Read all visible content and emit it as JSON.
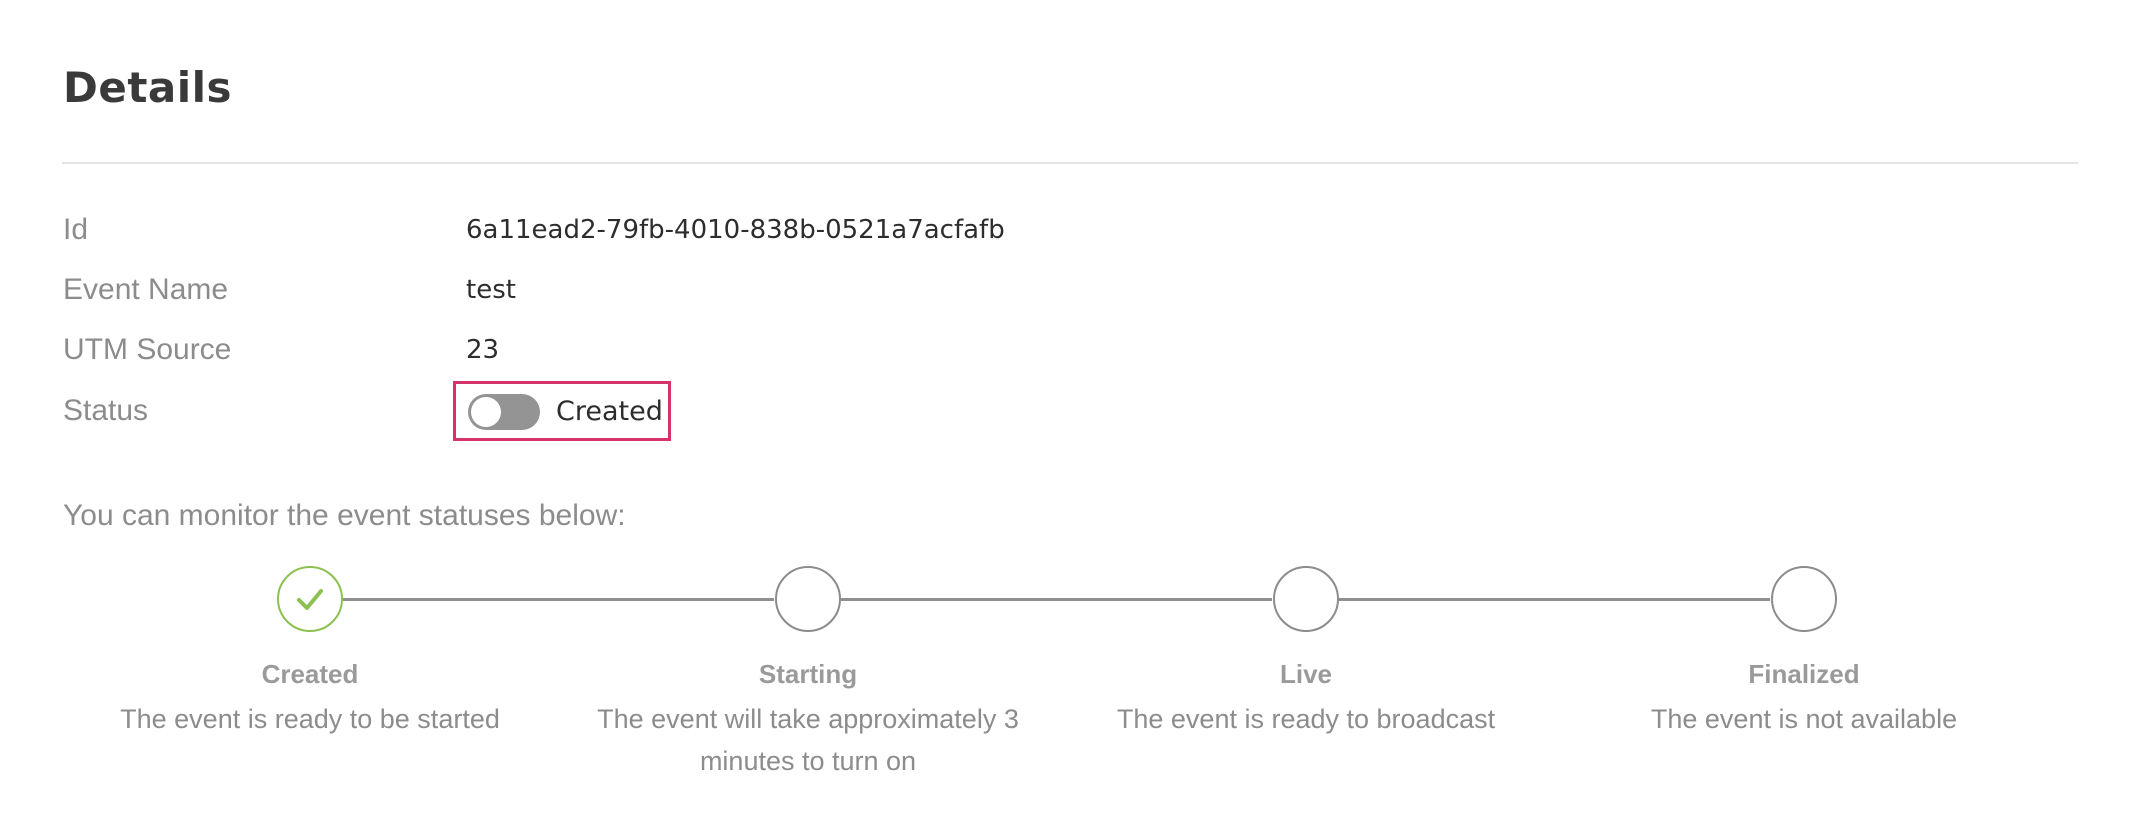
{
  "page_title": "Details",
  "fields": [
    {
      "label": "Id",
      "value": "6a11ead2-79fb-4010-838b-0521a7acfafb"
    },
    {
      "label": "Event Name",
      "value": "test"
    },
    {
      "label": "UTM Source",
      "value": "23"
    }
  ],
  "status": {
    "label": "Status",
    "toggle_on": false,
    "value": "Created"
  },
  "monitor_text": "You can monitor the event statuses below:",
  "steps": [
    {
      "name": "Created",
      "description": "The event is ready to be started",
      "completed": true
    },
    {
      "name": "Starting",
      "description": "The event will take approximately 3 minutes to turn on",
      "completed": false
    },
    {
      "name": "Live",
      "description": "The event is ready to broadcast",
      "completed": false
    },
    {
      "name": "Finalized",
      "description": "The event is not available",
      "completed": false
    }
  ],
  "colors": {
    "completed": "#8cc152",
    "highlight_border": "#d6336c",
    "toggle_off": "#949494"
  }
}
